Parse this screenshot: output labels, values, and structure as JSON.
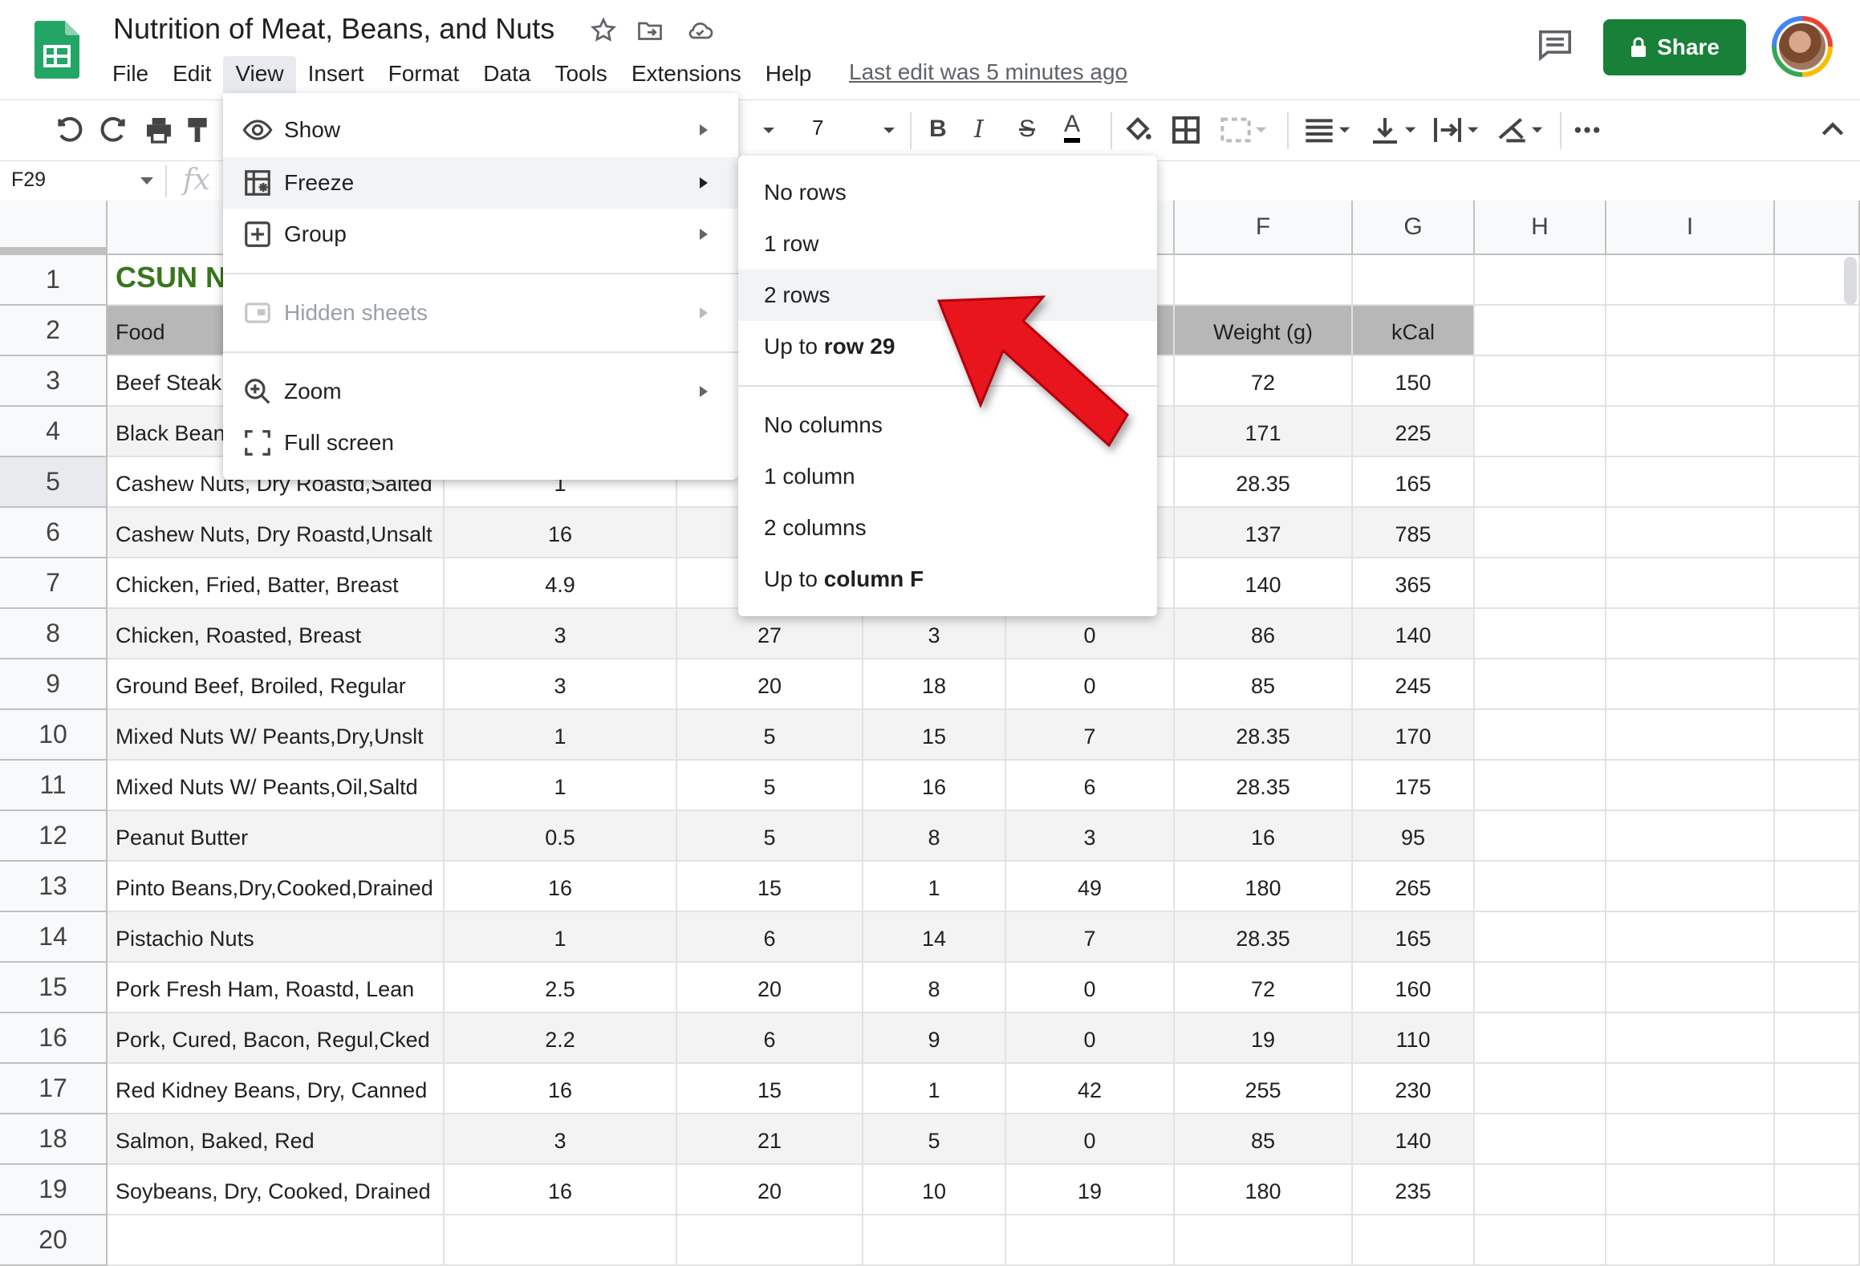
{
  "document": {
    "title": "Nutrition of Meat, Beans, and Nuts",
    "last_edit": "Last edit was 5 minutes ago"
  },
  "menubar": [
    "File",
    "Edit",
    "View",
    "Insert",
    "Format",
    "Data",
    "Tools",
    "Extensions",
    "Help"
  ],
  "share_label": "Share",
  "toolbar": {
    "font_size": "7"
  },
  "name_box": "F29",
  "fx_label": "fx",
  "columns": [
    "F",
    "G",
    "H",
    "I"
  ],
  "rows": [
    "1",
    "2",
    "3",
    "4",
    "5",
    "6",
    "7",
    "8",
    "9",
    "10",
    "11",
    "12",
    "13",
    "14",
    "15",
    "16",
    "17",
    "18",
    "19",
    "20"
  ],
  "title_cell": "CSUN N",
  "header_row": {
    "food": "Food",
    "weight": "Weight (g)",
    "kcal": "kCal"
  },
  "data_rows": [
    {
      "food": "Beef Steak",
      "b": "",
      "c": "",
      "d": "",
      "e": "",
      "weight": "72",
      "kcal": "150"
    },
    {
      "food": "Black Bean",
      "b": "",
      "c": "",
      "d": "",
      "e": "",
      "weight": "171",
      "kcal": "225"
    },
    {
      "food": "Cashew Nuts, Dry Roastd,Salted",
      "b": "1",
      "c": "",
      "d": "",
      "e": "",
      "weight": "28.35",
      "kcal": "165"
    },
    {
      "food": "Cashew Nuts, Dry Roastd,Unsalt",
      "b": "16",
      "c": "",
      "d": "",
      "e": "",
      "weight": "137",
      "kcal": "785"
    },
    {
      "food": "Chicken, Fried, Batter, Breast",
      "b": "4.9",
      "c": "",
      "d": "",
      "e": "",
      "weight": "140",
      "kcal": "365"
    },
    {
      "food": "Chicken, Roasted, Breast",
      "b": "3",
      "c": "27",
      "d": "3",
      "e": "0",
      "weight": "86",
      "kcal": "140"
    },
    {
      "food": "Ground Beef, Broiled, Regular",
      "b": "3",
      "c": "20",
      "d": "18",
      "e": "0",
      "weight": "85",
      "kcal": "245"
    },
    {
      "food": "Mixed Nuts W/ Peants,Dry,Unslt",
      "b": "1",
      "c": "5",
      "d": "15",
      "e": "7",
      "weight": "28.35",
      "kcal": "170"
    },
    {
      "food": "Mixed Nuts W/ Peants,Oil,Saltd",
      "b": "1",
      "c": "5",
      "d": "16",
      "e": "6",
      "weight": "28.35",
      "kcal": "175"
    },
    {
      "food": "Peanut Butter",
      "b": "0.5",
      "c": "5",
      "d": "8",
      "e": "3",
      "weight": "16",
      "kcal": "95"
    },
    {
      "food": "Pinto Beans,Dry,Cooked,Drained",
      "b": "16",
      "c": "15",
      "d": "1",
      "e": "49",
      "weight": "180",
      "kcal": "265"
    },
    {
      "food": "Pistachio Nuts",
      "b": "1",
      "c": "6",
      "d": "14",
      "e": "7",
      "weight": "28.35",
      "kcal": "165"
    },
    {
      "food": "Pork Fresh Ham, Roastd, Lean",
      "b": "2.5",
      "c": "20",
      "d": "8",
      "e": "0",
      "weight": "72",
      "kcal": "160"
    },
    {
      "food": "Pork, Cured, Bacon, Regul,Cked",
      "b": "2.2",
      "c": "6",
      "d": "9",
      "e": "0",
      "weight": "19",
      "kcal": "110"
    },
    {
      "food": "Red Kidney Beans, Dry, Canned",
      "b": "16",
      "c": "15",
      "d": "1",
      "e": "42",
      "weight": "255",
      "kcal": "230"
    },
    {
      "food": "Salmon, Baked, Red",
      "b": "3",
      "c": "21",
      "d": "5",
      "e": "0",
      "weight": "85",
      "kcal": "140"
    },
    {
      "food": "Soybeans, Dry, Cooked, Drained",
      "b": "16",
      "c": "20",
      "d": "10",
      "e": "19",
      "weight": "180",
      "kcal": "235"
    }
  ],
  "view_menu": {
    "show": "Show",
    "freeze": "Freeze",
    "group": "Group",
    "hidden_sheets": "Hidden sheets",
    "zoom": "Zoom",
    "full_screen": "Full screen"
  },
  "freeze_submenu": {
    "no_rows": "No rows",
    "one_row": "1 row",
    "two_rows": "2 rows",
    "up_to_row_prefix": "Up to ",
    "up_to_row_bold": "row 29",
    "no_columns": "No columns",
    "one_column": "1 column",
    "two_columns": "2 columns",
    "up_to_col_prefix": "Up to ",
    "up_to_col_bold": "column F"
  },
  "colors": {
    "share_green": "#188038",
    "title_green": "#38761d",
    "arrow_red": "#e8141c",
    "header_gray": "#b7b7b7"
  }
}
